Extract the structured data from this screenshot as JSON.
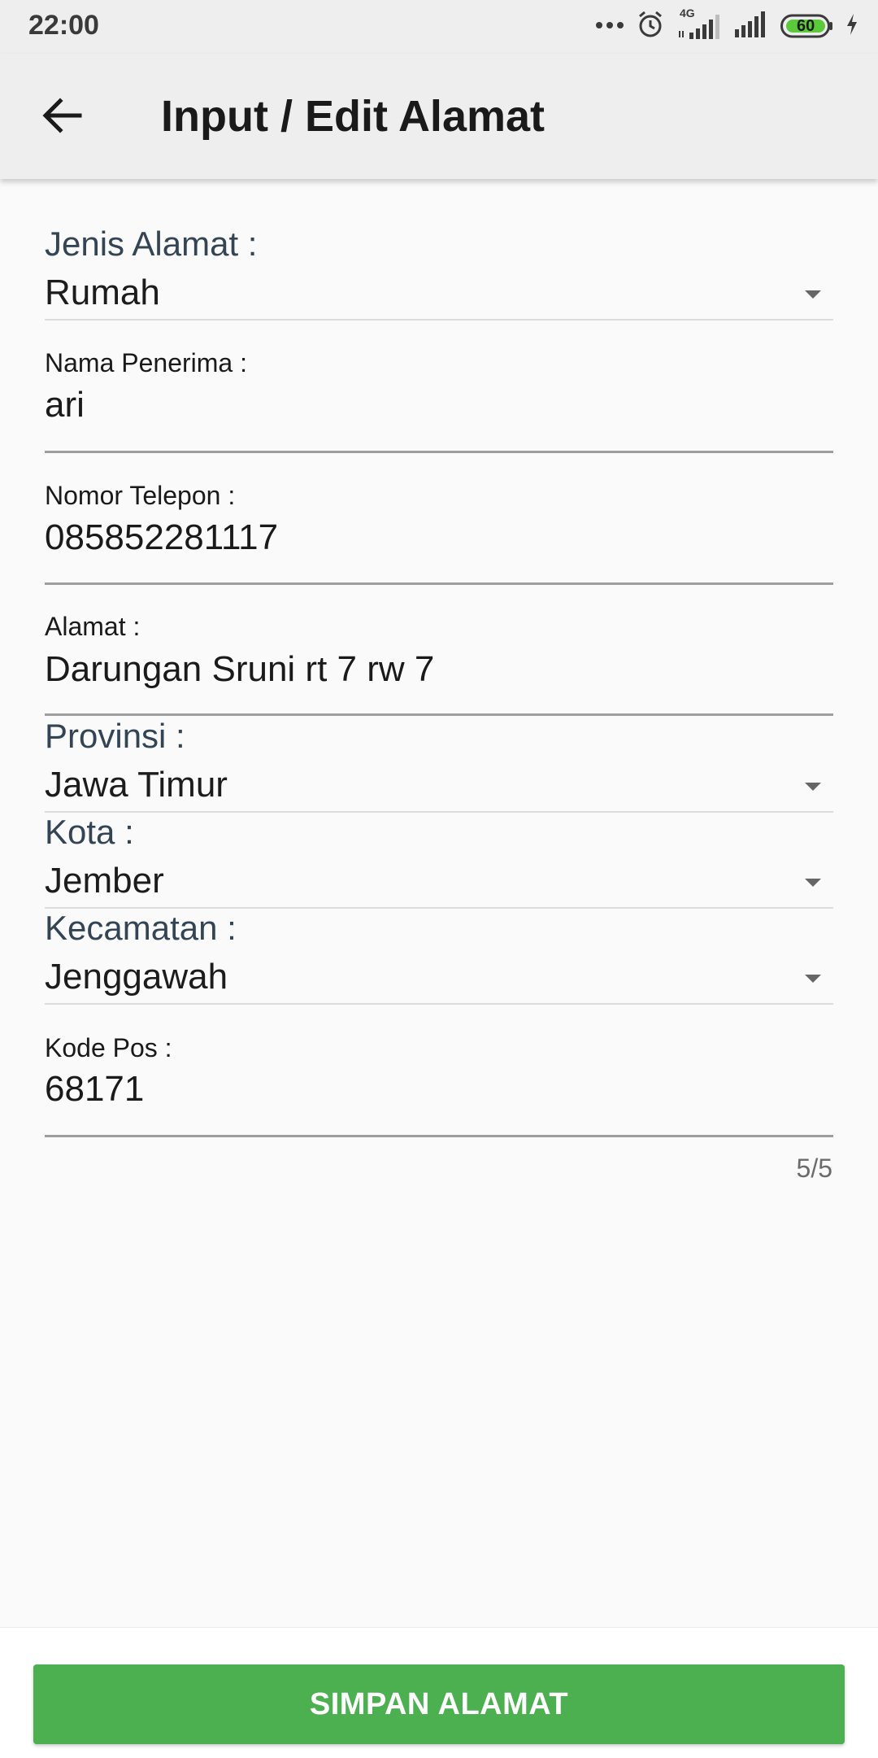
{
  "status_bar": {
    "time": "22:00",
    "network": "4G",
    "battery": "60"
  },
  "app_bar": {
    "title": "Input / Edit Alamat",
    "back_icon": "arrow-back-icon"
  },
  "form": {
    "jenis_alamat": {
      "label": "Jenis Alamat :",
      "value": "Rumah"
    },
    "nama_penerima": {
      "label": "Nama Penerima :",
      "value": "ari"
    },
    "nomor_telepon": {
      "label": "Nomor Telepon :",
      "value": "085852281117"
    },
    "alamat": {
      "label": "Alamat :",
      "value": "Darungan Sruni rt 7 rw 7"
    },
    "provinsi": {
      "label": "Provinsi :",
      "value": "Jawa Timur"
    },
    "kota": {
      "label": "Kota :",
      "value": "Jember"
    },
    "kecamatan": {
      "label": "Kecamatan :",
      "value": "Jenggawah"
    },
    "kode_pos": {
      "label": "Kode Pos :",
      "value": "68171",
      "counter": "5/5"
    }
  },
  "actions": {
    "save_label": "SIMPAN ALAMAT"
  },
  "colors": {
    "accent": "#4caf50",
    "appbar": "#eeeeee",
    "background": "#fafafa"
  }
}
